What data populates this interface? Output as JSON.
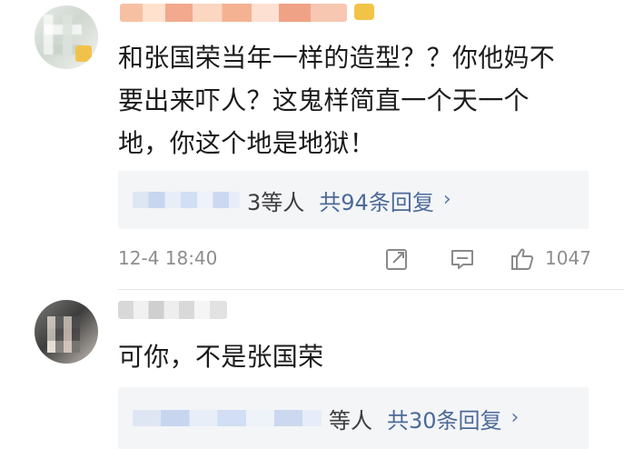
{
  "comments": [
    {
      "text_lines": [
        "和张国荣当年一样的造型？？你他妈不",
        "要出来吓人？这鬼样简直一个天一个",
        "地，你这个地是地狱！"
      ],
      "reply_summary": {
        "visible_suffix": "3等人",
        "reply_count_text": "共94条回复"
      },
      "time": "12-4 18:40",
      "likes": "1047"
    },
    {
      "text_lines": [
        "可你，不是张国荣"
      ],
      "reply_summary": {
        "visible_suffix": "等人",
        "reply_count_text": "共30条回复"
      }
    }
  ],
  "icons": {
    "share": "share-icon",
    "comment": "comment-icon",
    "like": "like-icon",
    "chevron": "chevron-right-icon"
  },
  "colors": {
    "link": "#4C6A98",
    "text": "#1B1B1B",
    "meta": "#8D8D8D",
    "reply_bg": "#F4F5F7"
  }
}
